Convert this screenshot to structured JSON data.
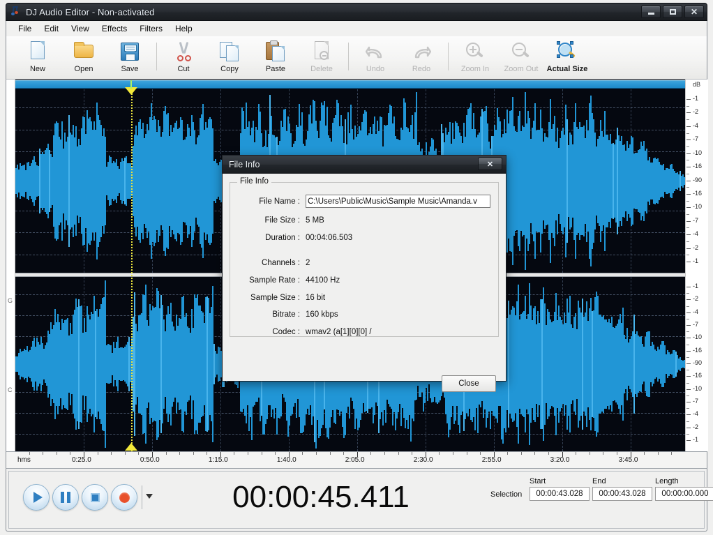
{
  "window": {
    "title": "DJ Audio Editor - Non-activated",
    "icon": "music-note-icon",
    "controls": {
      "minimize": "minimize",
      "maximize": "maximize",
      "close": "close"
    }
  },
  "menu": {
    "items": [
      {
        "label": "File",
        "accel": "F"
      },
      {
        "label": "Edit",
        "accel": "E"
      },
      {
        "label": "View",
        "accel": "V"
      },
      {
        "label": "Effects",
        "accel": "c"
      },
      {
        "label": "Filters",
        "accel": "l"
      },
      {
        "label": "Help",
        "accel": "H"
      }
    ]
  },
  "toolbar": {
    "buttons": [
      {
        "label": "New",
        "icon": "new-document-icon",
        "enabled": true
      },
      {
        "label": "Open",
        "icon": "open-folder-icon",
        "enabled": true
      },
      {
        "label": "Save",
        "icon": "floppy-disk-icon",
        "enabled": true
      },
      {
        "label": "Cut",
        "icon": "scissors-icon",
        "enabled": true
      },
      {
        "label": "Copy",
        "icon": "copy-pages-icon",
        "enabled": true
      },
      {
        "label": "Paste",
        "icon": "clipboard-icon",
        "enabled": true
      },
      {
        "label": "Delete",
        "icon": "delete-document-icon",
        "enabled": false
      },
      {
        "label": "Undo",
        "icon": "undo-arrow-icon",
        "enabled": false
      },
      {
        "label": "Redo",
        "icon": "redo-arrow-icon",
        "enabled": false
      },
      {
        "label": "Zoom In",
        "icon": "zoom-in-icon",
        "enabled": false
      },
      {
        "label": "Zoom Out",
        "icon": "zoom-out-icon",
        "enabled": false
      },
      {
        "label": "Actual Size",
        "icon": "actual-size-icon",
        "enabled": true
      }
    ]
  },
  "waveform": {
    "channel_labels": [
      "G",
      "C"
    ],
    "db_axis_title": "dB",
    "db_values": [
      "-1",
      "-2",
      "-4",
      "-7",
      "-10",
      "-16",
      "-90",
      "-16",
      "-10",
      "-7",
      "-4",
      "-2",
      "-1"
    ],
    "playhead_time": "0:45.4",
    "selection_bar_color": "#2a96d4",
    "waveform_color": "#2196d6",
    "background_color": "#050810",
    "playhead_color": "#f2e83a"
  },
  "ruler": {
    "unit_label": "hms",
    "ticks": [
      "0:25.0",
      "0:50.0",
      "1:15.0",
      "1:40.0",
      "2:05.0",
      "2:30.0",
      "2:55.0",
      "3:20.0",
      "3:45.0"
    ]
  },
  "transport": {
    "play": "play-button",
    "pause": "pause-button",
    "stop": "stop-button",
    "record": "record-button",
    "dropdown": "record-options-dropdown",
    "current_time": "00:00:45.411"
  },
  "selection": {
    "label": "Selection",
    "start_caption": "Start",
    "start_value": "00:00:43.028",
    "end_caption": "End",
    "end_value": "00:00:43.028",
    "length_caption": "Length",
    "length_value": "00:00:00.000"
  },
  "dialog": {
    "title": "File Info",
    "close_glyph": "x",
    "group_caption": "File Info",
    "fields": [
      {
        "key": "File Name :",
        "value": "C:\\Users\\Public\\Music\\Sample Music\\Amanda.v",
        "type": "input"
      },
      {
        "key": "File Size :",
        "value": "5 MB",
        "type": "text"
      },
      {
        "key": "Duration :",
        "value": "00:04:06.503",
        "type": "text"
      },
      {
        "key": "Channels :",
        "value": "2",
        "type": "text"
      },
      {
        "key": "Sample Rate :",
        "value": "44100 Hz",
        "type": "text"
      },
      {
        "key": "Sample Size :",
        "value": "16 bit",
        "type": "text"
      },
      {
        "key": "Bitrate :",
        "value": "160 kbps",
        "type": "text"
      },
      {
        "key": "Codec :",
        "value": "wmav2 (a[1][0][0] /",
        "type": "text"
      }
    ],
    "close_button": "Close"
  }
}
